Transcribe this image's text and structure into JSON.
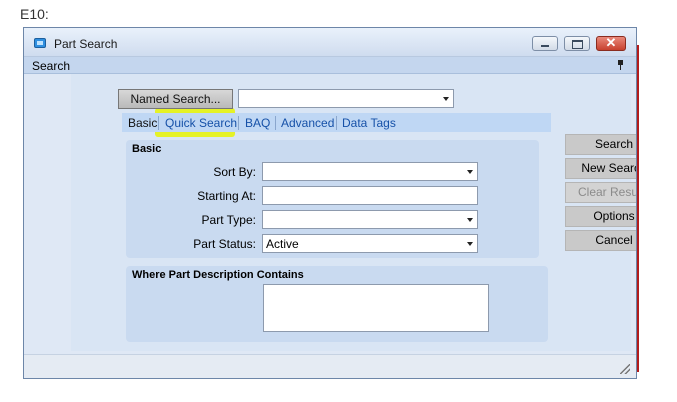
{
  "caption": "E10:",
  "window": {
    "title": "Part Search",
    "close_glyph": "✕"
  },
  "menubar": {
    "label": "Search"
  },
  "named_search": {
    "button_label": "Named Search...",
    "value": ""
  },
  "tabs": [
    {
      "label": "Basic",
      "active": true
    },
    {
      "label": "Quick Search",
      "highlighted": true
    },
    {
      "label": "BAQ"
    },
    {
      "label": "Advanced"
    },
    {
      "label": "Data Tags"
    }
  ],
  "basic_group": {
    "title": "Basic",
    "fields": {
      "sort_by": {
        "label": "Sort By:",
        "value": ""
      },
      "starting_at": {
        "label": "Starting At:",
        "value": ""
      },
      "part_type": {
        "label": "Part Type:",
        "value": ""
      },
      "part_status": {
        "label": "Part Status:",
        "value": "Active"
      }
    }
  },
  "description_group": {
    "title": "Where Part Description Contains",
    "value": ""
  },
  "actions": {
    "search": "Search",
    "new_search": "New Search",
    "clear_results": "Clear Results",
    "options": "Options",
    "cancel": "Cancel"
  },
  "colors": {
    "highlight": "#e6f21a",
    "link": "#1651a8",
    "window_bg": "#dde8f6"
  },
  "icons": [
    "app-icon",
    "minimize-icon",
    "maximize-icon",
    "close-icon",
    "pin-icon",
    "dropdown-arrow-icon",
    "resize-grip-icon"
  ]
}
